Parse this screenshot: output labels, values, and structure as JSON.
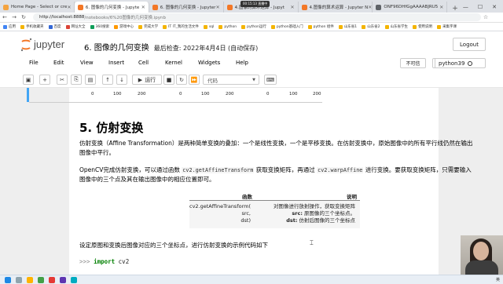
{
  "browser": {
    "tabs": [
      {
        "label": "Home Page - Select or cre",
        "color": "#f4a340",
        "active": false
      },
      {
        "label": "6. 图像的几何变换 - Jupyte",
        "color": "#f37726",
        "active": true
      },
      {
        "label": "6. 图像的几何变换 - Jupyter",
        "color": "#f37726",
        "active": false
      },
      {
        "label": "4.图像的算术运算 - Jupyt",
        "color": "#f37726",
        "active": false
      },
      {
        "label": "4.图像的算术运算 - Jupyter N",
        "color": "#f37726",
        "active": false
      },
      {
        "label": "ONF96DHfGgAAAABJRU5",
        "color": "#5f6368",
        "active": false
      }
    ],
    "recording_label": "00:15:13  直播中",
    "url_host": "http://localhost:8888",
    "url_path": "/notebooks/6%20图像的几何变换.ipynb",
    "bookmarks": [
      "应用",
      "手机收藏夹",
      "百度",
      "网址大全",
      "360搜索",
      "游戏中心",
      "完成大学",
      "IT IT_我的生活文件",
      "sql",
      "python",
      "python运行",
      "python基础入门",
      "python 组件",
      "山东省1",
      "山东省2",
      "山东省学生",
      "使用说明",
      "采集字课",
      "百度网盘",
      "其他书签"
    ]
  },
  "jupyter": {
    "logo_text": "jupyter",
    "notebook_title": "6. 图像的几何变换",
    "save_status": "最后检查: 2022年4月4日  (自动保存)",
    "logout_label": "Logout",
    "menu": [
      "File",
      "Edit",
      "View",
      "Insert",
      "Cell",
      "Kernel",
      "Widgets",
      "Help"
    ],
    "trusted_label": "不可信",
    "kernel_name": "python39",
    "run_label": "运行",
    "cell_type": "代码"
  },
  "output_axis": {
    "ticks_a": [
      "0",
      "100",
      "200"
    ],
    "ticks_b": [
      "0",
      "100",
      "200"
    ],
    "ticks_c": [
      "0",
      "100",
      "200"
    ]
  },
  "section": {
    "heading": "5. 仿射变换",
    "para1": "仿射变换（Affine Transformation）是两种简单变换的叠加：一个是线性变换，一个是平移变换。在仿射变换中，原始图像中的所有平行线仍然在输出图像中平行。",
    "para2_a": "OpenCV完成仿射变换，可以通过函数 ",
    "para2_code1": "cv2.getAffineTransform",
    "para2_b": " 获取变换矩阵，再通过 ",
    "para2_code2": "cv2.warpAffine",
    "para2_c": " 进行变换。要获取变换矩阵，只需要输入图像中的三个点及其在输出图像中的相应位置即可。",
    "table": {
      "col_func": "函数",
      "col_desc": "说明",
      "func_line1": "cv2.getAffineTransform(",
      "func_line2": "src,",
      "func_line3": "dst)",
      "desc_line1": "对图像进行放射操作，获取变换矩阵",
      "desc_src_key": "src:",
      "desc_src_val": " 原图像的三个坐标点。",
      "desc_dst_key": "dst:",
      "desc_dst_val": " 仿射后图像的三个坐标点"
    },
    "para3": "设定原图和变换后图像对应的三个坐标点，进行仿射变换的示例代码如下",
    "code_prompt": ">>>",
    "code_keyword": "import",
    "code_module": " cv2"
  },
  "taskbar": {
    "tray_text": "英",
    "time": ""
  }
}
